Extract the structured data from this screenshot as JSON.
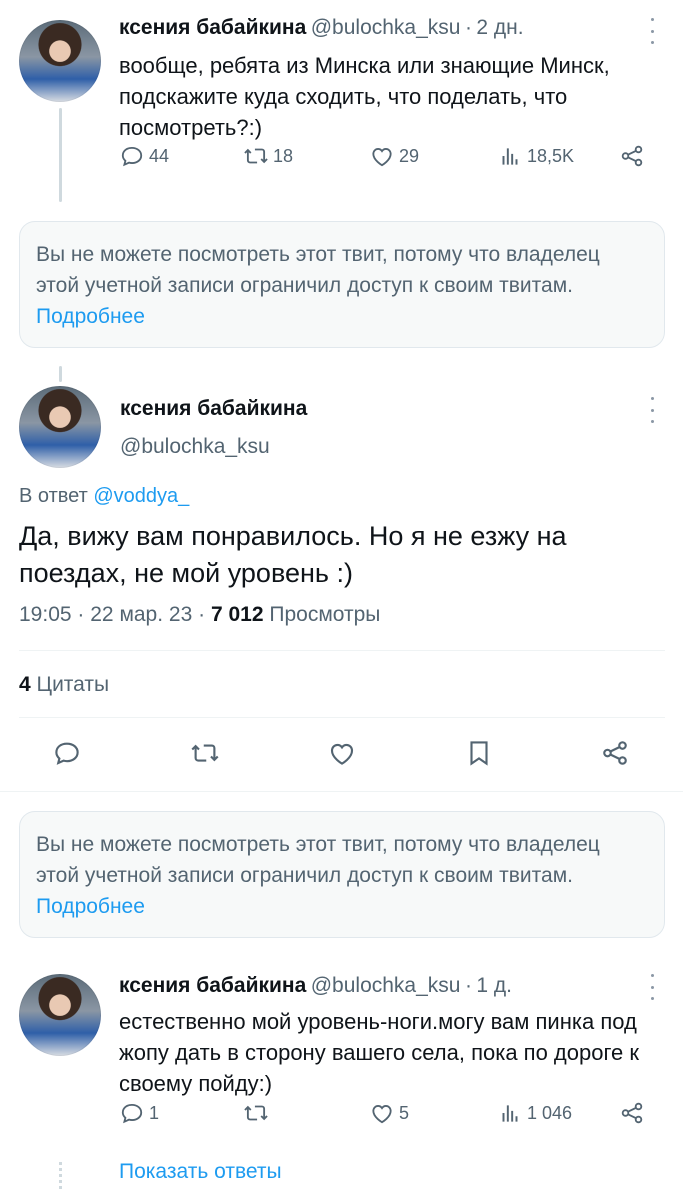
{
  "tweet1": {
    "name": "ксения бабайкина",
    "handle": "@bulochka_ksu",
    "sep": "·",
    "time": "2 дн.",
    "text": "вообще, ребята из Минска или знающие Минск, подскажите куда сходить, что поделать, что посмотреть?:)",
    "replies": "44",
    "retweets": "18",
    "likes": "29",
    "views": "18,5K"
  },
  "notice1": {
    "text": "Вы не можете посмотреть этот твит, потому что владелец этой учетной записи ограничил доступ к своим твитам.",
    "link": "Подробнее"
  },
  "main": {
    "name": "ксения бабайкина",
    "handle": "@bulochka_ksu",
    "reply_prefix": "В ответ",
    "reply_to": "@voddya_",
    "text": "Да, вижу вам понравилось. Но я не езжу на поездах, не мой уровень :)",
    "time": "19:05",
    "date": "22 мар. 23",
    "views_count": "7 012",
    "views_label": "Просмотры",
    "quotes_count": "4",
    "quotes_label": "Цитаты"
  },
  "notice2": {
    "text": "Вы не можете посмотреть этот твит, потому что владелец этой учетной записи ограничил доступ к своим твитам.",
    "link": "Подробнее"
  },
  "tweet3": {
    "name": "ксения бабайкина",
    "handle": "@bulochka_ksu",
    "sep": "·",
    "time": "1 д.",
    "text": "естественно мой уровень-ноги.могу вам пинка под жопу дать в сторону вашего села, пока по дороге к своему пойду:)",
    "replies": "1",
    "retweets": "",
    "likes": "5",
    "views": "1 046",
    "show_replies": "Показать ответы"
  },
  "colors": {
    "accent": "#1d9bf0",
    "text": "#0f1419",
    "secondary": "#536471"
  }
}
